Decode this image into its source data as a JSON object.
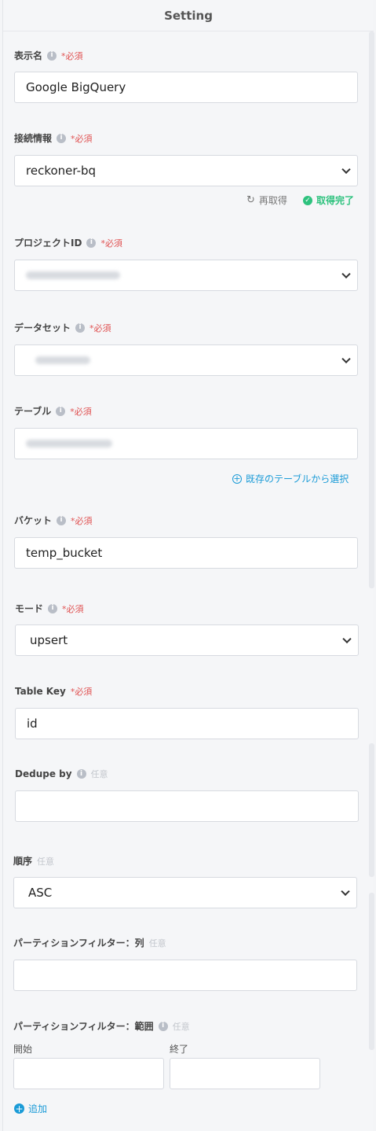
{
  "panel": {
    "title": "Setting"
  },
  "fields": {
    "display_name": {
      "label": "表示名",
      "required": "*必須",
      "value": "Google BigQuery"
    },
    "connection": {
      "label": "接続情報",
      "required": "*必須",
      "value": "reckoner-bq",
      "refresh": "再取得",
      "status": "取得完了"
    },
    "project_id": {
      "label": "プロジェクトID",
      "required": "*必須"
    },
    "dataset": {
      "label": "データセット",
      "required": "*必須"
    },
    "table": {
      "label": "テーブル",
      "required": "*必須",
      "select_existing": "既存のテーブルから選択"
    },
    "bucket": {
      "label": "バケット",
      "required": "*必須",
      "value": "temp_bucket"
    },
    "mode": {
      "label": "モード",
      "required": "*必須",
      "value": "upsert"
    },
    "table_key": {
      "label": "Table Key",
      "required": "*必須",
      "value": "id"
    },
    "dedupe_by": {
      "label": "Dedupe by",
      "optional": "任意",
      "value": ""
    },
    "order": {
      "label": "順序",
      "optional": "任意",
      "value": "ASC"
    },
    "partition_column": {
      "label": "パーティションフィルター：列",
      "optional": "任意",
      "value": ""
    },
    "partition_range": {
      "label": "パーティションフィルター：範囲",
      "optional": "任意",
      "start_label": "開始",
      "end_label": "終了",
      "add": "追加"
    }
  },
  "colors": {
    "required": "#e05252",
    "accent": "#1a9bd7",
    "success": "#2ec27e"
  },
  "icons": {
    "info": "info-icon",
    "chevron": "chevron-down-icon",
    "refresh": "refresh-icon",
    "check": "check-circle-icon",
    "plus": "plus-circle-icon"
  }
}
